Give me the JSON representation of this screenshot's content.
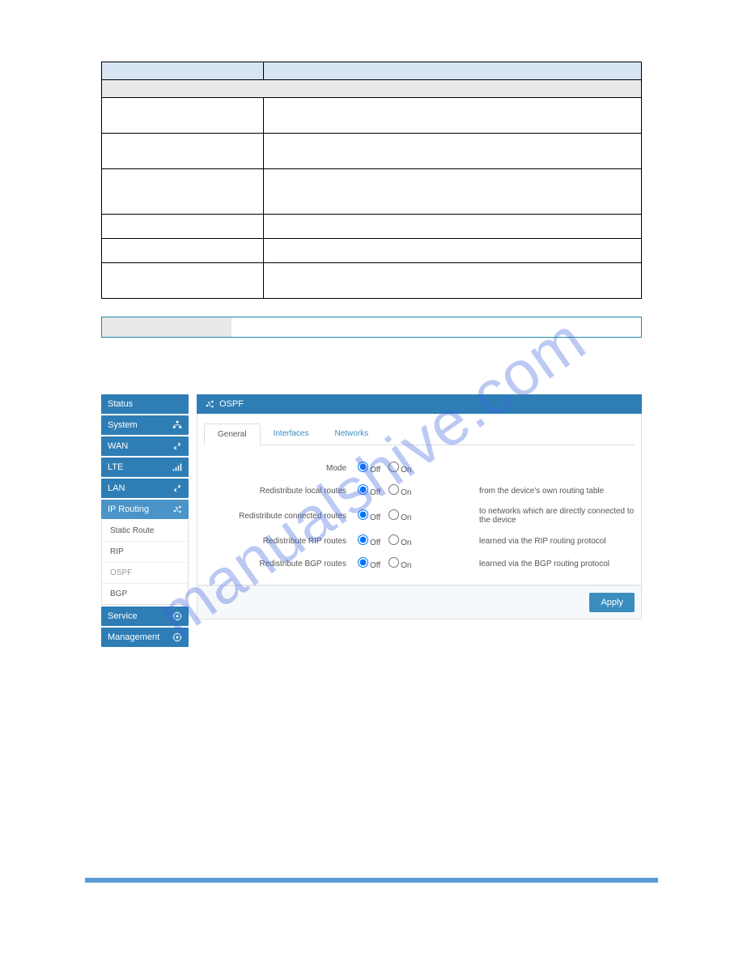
{
  "watermark": "manualshive.com",
  "table": {
    "header_param": "",
    "header_desc": "",
    "sub_header": "",
    "rows": [
      {
        "p": "",
        "d": ""
      },
      {
        "p": "",
        "d": ""
      },
      {
        "p": "",
        "d": ""
      },
      {
        "p": "",
        "d": ""
      },
      {
        "p": "",
        "d": ""
      },
      {
        "p": "",
        "d": ""
      }
    ]
  },
  "sidebar": {
    "items": [
      {
        "label": "Status",
        "icon": ""
      },
      {
        "label": "System",
        "icon": "sitemap"
      },
      {
        "label": "WAN",
        "icon": "exchange"
      },
      {
        "label": "LTE",
        "icon": "signal"
      },
      {
        "label": "LAN",
        "icon": "exchange"
      },
      {
        "label": "IP Routing",
        "icon": "shuffle"
      },
      {
        "label": "Service",
        "icon": "gear"
      },
      {
        "label": "Management",
        "icon": "gear"
      }
    ],
    "sub": [
      "Static Route",
      "RIP",
      "OSPF",
      "BGP"
    ]
  },
  "panel": {
    "title": "OSPF",
    "tabs": [
      "General",
      "Interfaces",
      "Networks"
    ],
    "rows": [
      {
        "label": "Mode",
        "desc": ""
      },
      {
        "label": "Redistribute local routes",
        "desc": "from the device's own routing table"
      },
      {
        "label": "Redistribute connected routes",
        "desc": "to networks which are directly connected to the device"
      },
      {
        "label": "Redistribute RIP routes",
        "desc": "learned via the RIP routing protocol"
      },
      {
        "label": "Redistribute BGP routes",
        "desc": "learned via the BGP routing protocol"
      }
    ],
    "off": "Off",
    "on": "On",
    "apply": "Apply"
  }
}
